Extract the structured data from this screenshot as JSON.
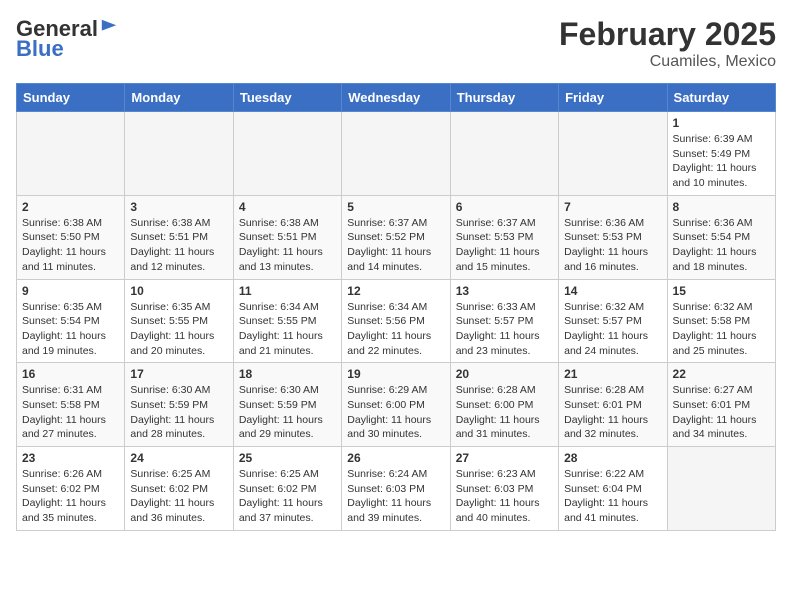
{
  "logo": {
    "general": "General",
    "blue": "Blue"
  },
  "title": "February 2025",
  "subtitle": "Cuamiles, Mexico",
  "weekdays": [
    "Sunday",
    "Monday",
    "Tuesday",
    "Wednesday",
    "Thursday",
    "Friday",
    "Saturday"
  ],
  "weeks": [
    [
      {
        "day": "",
        "info": ""
      },
      {
        "day": "",
        "info": ""
      },
      {
        "day": "",
        "info": ""
      },
      {
        "day": "",
        "info": ""
      },
      {
        "day": "",
        "info": ""
      },
      {
        "day": "",
        "info": ""
      },
      {
        "day": "1",
        "info": "Sunrise: 6:39 AM\nSunset: 5:49 PM\nDaylight: 11 hours\nand 10 minutes."
      }
    ],
    [
      {
        "day": "2",
        "info": "Sunrise: 6:38 AM\nSunset: 5:50 PM\nDaylight: 11 hours\nand 11 minutes."
      },
      {
        "day": "3",
        "info": "Sunrise: 6:38 AM\nSunset: 5:51 PM\nDaylight: 11 hours\nand 12 minutes."
      },
      {
        "day": "4",
        "info": "Sunrise: 6:38 AM\nSunset: 5:51 PM\nDaylight: 11 hours\nand 13 minutes."
      },
      {
        "day": "5",
        "info": "Sunrise: 6:37 AM\nSunset: 5:52 PM\nDaylight: 11 hours\nand 14 minutes."
      },
      {
        "day": "6",
        "info": "Sunrise: 6:37 AM\nSunset: 5:53 PM\nDaylight: 11 hours\nand 15 minutes."
      },
      {
        "day": "7",
        "info": "Sunrise: 6:36 AM\nSunset: 5:53 PM\nDaylight: 11 hours\nand 16 minutes."
      },
      {
        "day": "8",
        "info": "Sunrise: 6:36 AM\nSunset: 5:54 PM\nDaylight: 11 hours\nand 18 minutes."
      }
    ],
    [
      {
        "day": "9",
        "info": "Sunrise: 6:35 AM\nSunset: 5:54 PM\nDaylight: 11 hours\nand 19 minutes."
      },
      {
        "day": "10",
        "info": "Sunrise: 6:35 AM\nSunset: 5:55 PM\nDaylight: 11 hours\nand 20 minutes."
      },
      {
        "day": "11",
        "info": "Sunrise: 6:34 AM\nSunset: 5:55 PM\nDaylight: 11 hours\nand 21 minutes."
      },
      {
        "day": "12",
        "info": "Sunrise: 6:34 AM\nSunset: 5:56 PM\nDaylight: 11 hours\nand 22 minutes."
      },
      {
        "day": "13",
        "info": "Sunrise: 6:33 AM\nSunset: 5:57 PM\nDaylight: 11 hours\nand 23 minutes."
      },
      {
        "day": "14",
        "info": "Sunrise: 6:32 AM\nSunset: 5:57 PM\nDaylight: 11 hours\nand 24 minutes."
      },
      {
        "day": "15",
        "info": "Sunrise: 6:32 AM\nSunset: 5:58 PM\nDaylight: 11 hours\nand 25 minutes."
      }
    ],
    [
      {
        "day": "16",
        "info": "Sunrise: 6:31 AM\nSunset: 5:58 PM\nDaylight: 11 hours\nand 27 minutes."
      },
      {
        "day": "17",
        "info": "Sunrise: 6:30 AM\nSunset: 5:59 PM\nDaylight: 11 hours\nand 28 minutes."
      },
      {
        "day": "18",
        "info": "Sunrise: 6:30 AM\nSunset: 5:59 PM\nDaylight: 11 hours\nand 29 minutes."
      },
      {
        "day": "19",
        "info": "Sunrise: 6:29 AM\nSunset: 6:00 PM\nDaylight: 11 hours\nand 30 minutes."
      },
      {
        "day": "20",
        "info": "Sunrise: 6:28 AM\nSunset: 6:00 PM\nDaylight: 11 hours\nand 31 minutes."
      },
      {
        "day": "21",
        "info": "Sunrise: 6:28 AM\nSunset: 6:01 PM\nDaylight: 11 hours\nand 32 minutes."
      },
      {
        "day": "22",
        "info": "Sunrise: 6:27 AM\nSunset: 6:01 PM\nDaylight: 11 hours\nand 34 minutes."
      }
    ],
    [
      {
        "day": "23",
        "info": "Sunrise: 6:26 AM\nSunset: 6:02 PM\nDaylight: 11 hours\nand 35 minutes."
      },
      {
        "day": "24",
        "info": "Sunrise: 6:25 AM\nSunset: 6:02 PM\nDaylight: 11 hours\nand 36 minutes."
      },
      {
        "day": "25",
        "info": "Sunrise: 6:25 AM\nSunset: 6:02 PM\nDaylight: 11 hours\nand 37 minutes."
      },
      {
        "day": "26",
        "info": "Sunrise: 6:24 AM\nSunset: 6:03 PM\nDaylight: 11 hours\nand 39 minutes."
      },
      {
        "day": "27",
        "info": "Sunrise: 6:23 AM\nSunset: 6:03 PM\nDaylight: 11 hours\nand 40 minutes."
      },
      {
        "day": "28",
        "info": "Sunrise: 6:22 AM\nSunset: 6:04 PM\nDaylight: 11 hours\nand 41 minutes."
      },
      {
        "day": "",
        "info": ""
      }
    ]
  ]
}
